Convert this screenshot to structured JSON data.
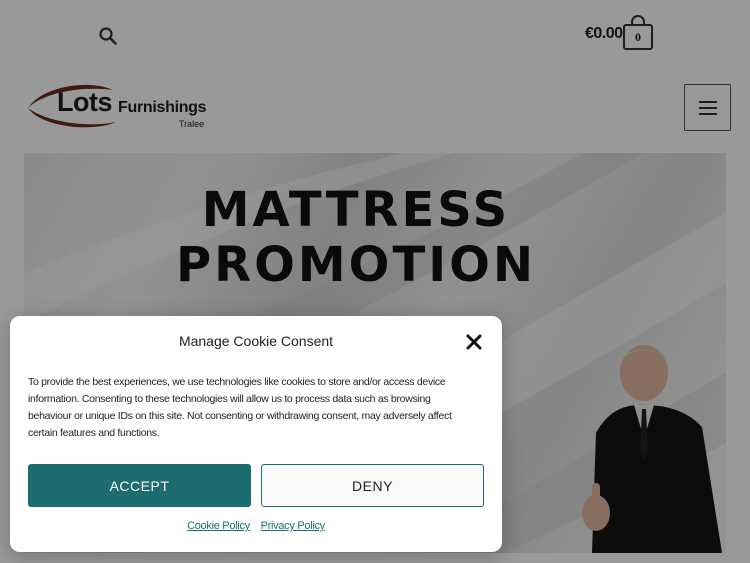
{
  "header": {
    "search_icon": "search-icon",
    "cart_total": "€0.00",
    "cart_count": "0",
    "cart_icon": "shopping-bag-icon"
  },
  "logo": {
    "name": "Lots",
    "subname": "Furnishings",
    "location": "Tralee"
  },
  "menu": {
    "icon": "hamburger-menu-icon"
  },
  "hero": {
    "title_line1": "MATTRESS",
    "title_line2": "PROMOTION"
  },
  "cookie_modal": {
    "title": "Manage Cookie Consent",
    "message": "To provide the best experiences, we use technologies like cookies to store and/or access device information. Consenting to these technologies will allow us to process data such as browsing behaviour or unique IDs on this site. Not consenting or withdrawing consent, may adversely affect certain features and functions.",
    "accept_label": "ACCEPT",
    "deny_label": "DENY",
    "cookie_policy_label": "Cookie Policy",
    "privacy_policy_label": "Privacy Policy",
    "close_icon": "close-icon"
  },
  "colors": {
    "accent": "#1d6d70",
    "logo_brown": "#6b2a1a"
  }
}
